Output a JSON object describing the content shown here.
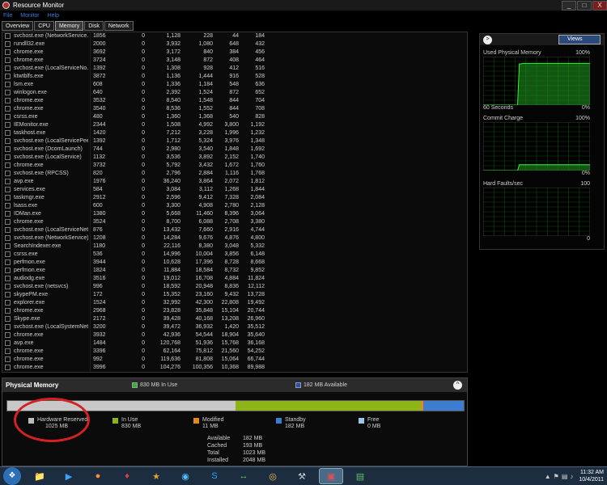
{
  "window": {
    "title": "Resource Monitor",
    "buttons": [
      "_",
      "□",
      "X"
    ]
  },
  "menu": [
    "File",
    "Monitor",
    "Help"
  ],
  "tabs": [
    {
      "label": "Overview",
      "active": false
    },
    {
      "label": "CPU",
      "active": false
    },
    {
      "label": "Memory",
      "active": true
    },
    {
      "label": "Disk",
      "active": false
    },
    {
      "label": "Network",
      "active": false
    }
  ],
  "processes": [
    [
      "svchost.exe (NetworkService...",
      "1856",
      "0",
      "1,128",
      "228",
      "44",
      "184"
    ],
    [
      "rundll32.exe",
      "2000",
      "0",
      "3,932",
      "1,080",
      "648",
      "432"
    ],
    [
      "chrome.exe",
      "3692",
      "0",
      "3,172",
      "840",
      "384",
      "456"
    ],
    [
      "chrome.exe",
      "3724",
      "0",
      "3,148",
      "872",
      "408",
      "464"
    ],
    [
      "svchost.exe (LocalServiceNo...",
      "1392",
      "0",
      "1,308",
      "928",
      "412",
      "516"
    ],
    [
      "ktwtblfs.exe",
      "3872",
      "0",
      "1,136",
      "1,444",
      "916",
      "528"
    ],
    [
      "lsm.exe",
      "608",
      "0",
      "1,336",
      "1,184",
      "548",
      "636"
    ],
    [
      "winlogon.exe",
      "640",
      "0",
      "2,392",
      "1,524",
      "872",
      "652"
    ],
    [
      "chrome.exe",
      "3532",
      "0",
      "8,540",
      "1,548",
      "844",
      "704"
    ],
    [
      "chrome.exe",
      "3540",
      "0",
      "8,536",
      "1,552",
      "844",
      "708"
    ],
    [
      "csrss.exe",
      "480",
      "0",
      "1,360",
      "1,368",
      "540",
      "828"
    ],
    [
      "IEMonitor.exe",
      "2344",
      "0",
      "1,508",
      "4,992",
      "3,800",
      "1,192"
    ],
    [
      "taskhost.exe",
      "1420",
      "0",
      "7,212",
      "3,228",
      "1,996",
      "1,232"
    ],
    [
      "svchost.exe (LocalServicePee...",
      "1392",
      "0",
      "1,712",
      "5,324",
      "3,976",
      "1,348"
    ],
    [
      "svchost.exe (DcomLaunch)",
      "744",
      "0",
      "2,980",
      "3,540",
      "1,848",
      "1,692"
    ],
    [
      "svchost.exe (LocalService)",
      "1132",
      "0",
      "3,536",
      "3,892",
      "2,152",
      "1,740"
    ],
    [
      "chrome.exe",
      "3732",
      "0",
      "5,792",
      "3,432",
      "1,672",
      "1,760"
    ],
    [
      "svchost.exe (RPCSS)",
      "820",
      "0",
      "2,796",
      "2,884",
      "1,116",
      "1,768"
    ],
    [
      "avp.exe",
      "1976",
      "0",
      "36,240",
      "3,864",
      "2,072",
      "1,812"
    ],
    [
      "services.exe",
      "584",
      "0",
      "3,084",
      "3,112",
      "1,268",
      "1,844"
    ],
    [
      "taskmgr.exe",
      "2912",
      "0",
      "2,596",
      "9,412",
      "7,328",
      "2,084"
    ],
    [
      "lsass.exe",
      "600",
      "0",
      "3,300",
      "4,908",
      "2,780",
      "2,128"
    ],
    [
      "IDMan.exe",
      "1380",
      "0",
      "5,668",
      "11,460",
      "8,396",
      "3,064"
    ],
    [
      "chrome.exe",
      "3524",
      "0",
      "8,700",
      "6,088",
      "2,708",
      "3,380"
    ],
    [
      "svchost.exe (LocalServiceNet...",
      "876",
      "0",
      "13,432",
      "7,660",
      "2,916",
      "4,744"
    ],
    [
      "svchost.exe (NetworkService)",
      "1208",
      "0",
      "14,284",
      "9,676",
      "4,876",
      "4,800"
    ],
    [
      "SearchIndexer.exe",
      "1180",
      "0",
      "22,116",
      "8,380",
      "3,048",
      "5,332"
    ],
    [
      "csrss.exe",
      "536",
      "0",
      "14,996",
      "10,004",
      "3,856",
      "6,148"
    ],
    [
      "perfmon.exe",
      "3944",
      "0",
      "10,628",
      "17,396",
      "8,728",
      "8,668"
    ],
    [
      "perfmon.exe",
      "1824",
      "0",
      "11,884",
      "18,584",
      "8,732",
      "9,852"
    ],
    [
      "audiodg.exe",
      "3516",
      "0",
      "19,012",
      "16,708",
      "4,884",
      "11,824"
    ],
    [
      "svchost.exe (netsvcs)",
      "996",
      "0",
      "18,592",
      "20,948",
      "8,836",
      "12,112"
    ],
    [
      "skypePM.exe",
      "172",
      "0",
      "15,352",
      "23,160",
      "9,432",
      "13,728"
    ],
    [
      "explorer.exe",
      "1524",
      "0",
      "32,992",
      "42,300",
      "22,808",
      "19,492"
    ],
    [
      "chrome.exe",
      "2968",
      "0",
      "23,828",
      "35,848",
      "15,104",
      "20,744"
    ],
    [
      "Skype.exe",
      "2172",
      "0",
      "39,428",
      "40,168",
      "13,208",
      "26,960"
    ],
    [
      "svchost.exe (LocalSystemNet...",
      "3200",
      "0",
      "39,472",
      "36,932",
      "1,420",
      "35,512"
    ],
    [
      "chrome.exe",
      "3932",
      "0",
      "42,936",
      "54,544",
      "18,904",
      "35,640"
    ],
    [
      "avp.exe",
      "1484",
      "0",
      "120,768",
      "51,936",
      "15,768",
      "36,168"
    ],
    [
      "chrome.exe",
      "3396",
      "0",
      "62,164",
      "75,812",
      "21,560",
      "54,252"
    ],
    [
      "chrome.exe",
      "992",
      "0",
      "119,636",
      "81,808",
      "15,064",
      "66,744"
    ],
    [
      "chrome.exe",
      "3996",
      "0",
      "104,276",
      "100,356",
      "10,368",
      "89,988"
    ]
  ],
  "physical_memory": {
    "title": "Physical Memory",
    "in_use_chip": "830 MB In Use",
    "available_chip": "182 MB Available",
    "bar_segments": [
      {
        "key": "hardware_reserved",
        "mb": 1025,
        "color": "#c8c8c8"
      },
      {
        "key": "in_use",
        "mb": 830,
        "color": "#8db51a"
      },
      {
        "key": "modified",
        "mb": 11,
        "color": "#e08a1a"
      },
      {
        "key": "standby",
        "mb": 182,
        "color": "#3d7dd0"
      },
      {
        "key": "free",
        "mb": 0,
        "color": "#9cc4ee"
      }
    ],
    "legend": [
      {
        "label": "Hardware Reserved",
        "value": "1025 MB",
        "color": "#bcbcbc"
      },
      {
        "label": "In Use",
        "value": "830 MB",
        "color": "#8db51a"
      },
      {
        "label": "Modified",
        "value": "11 MB",
        "color": "#e08a1a"
      },
      {
        "label": "Standby",
        "value": "182 MB",
        "color": "#3d7dd0"
      },
      {
        "label": "Free",
        "value": "0 MB",
        "color": "#9cc4ee"
      }
    ],
    "stats": [
      {
        "label": "Available",
        "value": "182 MB"
      },
      {
        "label": "Cached",
        "value": "193 MB"
      },
      {
        "label": "Total",
        "value": "1023 MB"
      },
      {
        "label": "Installed",
        "value": "2048 MB"
      }
    ]
  },
  "right_panel": {
    "views_label": "Views",
    "graphs": [
      {
        "title": "Used Physical Memory",
        "max": "100%",
        "bottom_left": "60 Seconds",
        "bottom_right": "0%",
        "level_pct": [
          0,
          0,
          0,
          0,
          0,
          0,
          0,
          0,
          0,
          0,
          0,
          0,
          0,
          0,
          0,
          0,
          0,
          0,
          0,
          0,
          85,
          85,
          86,
          86,
          86,
          86,
          86,
          86,
          86,
          86,
          86,
          86,
          86,
          86,
          86,
          86,
          86,
          86,
          86,
          86,
          86,
          86,
          86,
          86,
          86,
          86,
          86,
          86,
          86,
          86,
          86,
          86,
          86,
          86,
          86,
          86,
          86,
          86,
          86,
          86
        ]
      },
      {
        "title": "Commit Charge",
        "max": "100%",
        "bottom_left": "",
        "bottom_right": "0%",
        "level_pct": [
          0,
          0,
          0,
          0,
          0,
          0,
          0,
          0,
          0,
          0,
          0,
          0,
          0,
          0,
          0,
          0,
          0,
          0,
          0,
          0,
          12,
          12,
          12,
          12,
          12,
          12,
          12,
          12,
          12,
          12,
          12,
          12,
          12,
          12,
          12,
          12,
          12,
          12,
          12,
          12,
          12,
          12,
          12,
          12,
          12,
          12,
          12,
          12,
          12,
          12,
          12,
          12,
          12,
          12,
          12,
          12,
          12,
          12,
          12,
          12
        ]
      },
      {
        "title": "Hard Faults/sec",
        "max": "100",
        "bottom_left": "",
        "bottom_right": "0",
        "level_pct": []
      }
    ]
  },
  "taskbar": {
    "start_icon": "windows-orb-icon",
    "items": [
      "explorer-icon",
      "media-player-icon",
      "firefox-icon",
      "idm-icon",
      "winamp-icon",
      "browser-icon",
      "skype-icon",
      "network-icon",
      "chrome-icon",
      "tool-icon",
      "resource-monitor-icon",
      "taskmgr-icon"
    ],
    "time": "11:32 AM",
    "date": "10/4/2011"
  }
}
